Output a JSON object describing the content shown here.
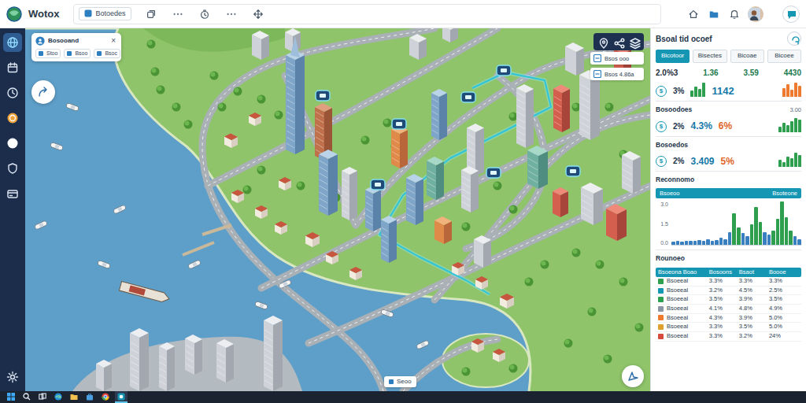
{
  "app": {
    "name": "Wotox"
  },
  "toolbar": {
    "tab": "Botoedes"
  },
  "sidebar": {
    "items": [
      {
        "kind": "globe",
        "selected": true
      },
      {
        "kind": "calendar",
        "selected": false
      },
      {
        "kind": "clock",
        "selected": false
      },
      {
        "kind": "coin",
        "selected": false
      },
      {
        "kind": "dot",
        "selected": false
      },
      {
        "kind": "shield",
        "selected": false
      },
      {
        "kind": "card",
        "selected": false
      }
    ]
  },
  "map": {
    "card": {
      "title": "Bosooand",
      "close": "×",
      "chips": [
        "Stoo",
        "Bsoo",
        "Bsoc"
      ]
    },
    "layers": [
      "Bsos ooo",
      "Bsos 4.86a"
    ],
    "label": "Seoo"
  },
  "panel": {
    "title": "Bsoal tid ocoef",
    "tabs": [
      {
        "label": "Bicotoor",
        "selected": true
      },
      {
        "label": "Bisectes",
        "selected": false
      },
      {
        "label": "Bicoae",
        "selected": false
      },
      {
        "label": "Bicoee",
        "selected": false
      }
    ],
    "summary": [
      {
        "text": "2.0%3",
        "color": "#1f2d3d"
      },
      {
        "text": "1.36",
        "color": "#1b7a4f"
      },
      {
        "text": "3.59",
        "color": "#1b7a4f"
      },
      {
        "text": "4430",
        "color": "#1b7a4f"
      }
    ],
    "metric": {
      "icon": "$",
      "percent": "3%",
      "bars": [
        3,
        5,
        4,
        7
      ],
      "value": "1142",
      "alt_bars": [
        5,
        7,
        4,
        8,
        6
      ]
    },
    "groups": [
      {
        "title": "Bosoodoes",
        "aside": "3.00",
        "icon": "$",
        "percent": "2%",
        "value": "4.3%",
        "change": "6%",
        "bars": [
          3,
          5,
          4,
          6,
          8,
          7
        ]
      },
      {
        "title": "Bosoedos",
        "icon": "$",
        "percent": "2%",
        "value": "3.409",
        "change": "5%",
        "bars": [
          4,
          3,
          6,
          5,
          8,
          7
        ]
      }
    ],
    "trend": {
      "title": "Reconnomo",
      "legend": [
        "Bsoeoo",
        "Bsoteone"
      ],
      "ticks": [
        "3.0",
        "1.5",
        "0.0"
      ],
      "values": [
        0.2,
        0.3,
        0.2,
        0.3,
        0.25,
        0.3,
        0.35,
        0.3,
        0.4,
        0.3,
        0.35,
        0.5,
        0.4,
        0.9,
        2.2,
        1.2,
        0.8,
        0.6,
        1.4,
        2.6,
        1.6,
        0.9,
        0.7,
        1.0,
        1.8,
        3.0,
        1.9,
        1.0,
        0.6,
        0.4
      ]
    },
    "table": {
      "title": "Rounoeo",
      "columns": [
        "Bsoeona Boao",
        "Bosoons",
        "Bsaot",
        "Boooe"
      ],
      "rows": [
        {
          "color": "#2e9e4f",
          "cells": [
            "Bsoeeal",
            "3.3%",
            "3.3%",
            "3.3%"
          ]
        },
        {
          "color": "#1597b3",
          "cells": [
            "Bsoeeal",
            "3.2%",
            "4.5%",
            "2.5%"
          ]
        },
        {
          "color": "#2e9e4f",
          "cells": [
            "Bsoeeal",
            "3.5%",
            "3.9%",
            "3.5%"
          ]
        },
        {
          "color": "#8a96a3",
          "cells": [
            "Bsoeeal",
            "4.1%",
            "4.8%",
            "4.9%"
          ]
        },
        {
          "color": "#ee7a2f",
          "cells": [
            "Bsoeeal",
            "4.3%",
            "3.9%",
            "5.0%"
          ]
        },
        {
          "color": "#e0a030",
          "cells": [
            "Bsoeeal",
            "3.3%",
            "3.5%",
            "5.0%"
          ]
        },
        {
          "color": "#d64b3c",
          "cells": [
            "Bsoeeal",
            "3.3%",
            "3.2%",
            "24%"
          ]
        }
      ]
    }
  },
  "taskbar": {
    "items": [
      {
        "kind": "start",
        "selected": false
      },
      {
        "kind": "search",
        "selected": false
      },
      {
        "kind": "taskview",
        "selected": false
      },
      {
        "kind": "edge",
        "selected": false
      },
      {
        "kind": "explorer",
        "selected": false
      },
      {
        "kind": "store",
        "selected": false
      },
      {
        "kind": "chrome",
        "selected": false
      },
      {
        "kind": "app",
        "selected": true
      }
    ]
  }
}
